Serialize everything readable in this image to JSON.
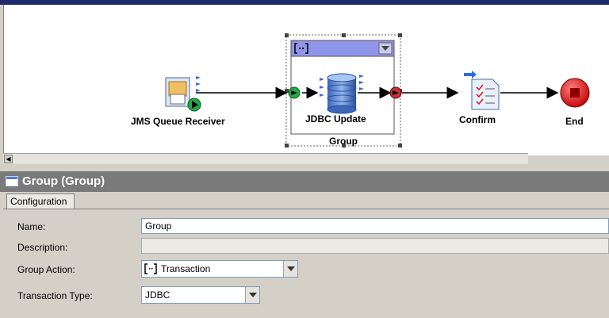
{
  "canvas": {
    "nodes": {
      "jms": "JMS Queue Receiver",
      "jdbc": "JDBC Update",
      "confirm": "Confirm",
      "end": "End"
    },
    "group_label": "Group"
  },
  "panel": {
    "title": "Group (Group)",
    "tab": "Configuration",
    "fields": {
      "name_label": "Name:",
      "name_value": "Group",
      "description_label": "Description:",
      "description_value": "",
      "group_action_label": "Group Action:",
      "group_action_value": "Transaction",
      "transaction_type_label": "Transaction Type:",
      "transaction_type_value": "JDBC"
    }
  },
  "icons": {
    "jms": "jms-queue-receiver-icon",
    "jdbc": "database-icon",
    "confirm": "confirm-checklist-icon",
    "end": "end-stop-icon",
    "group": "group-bracket-icon"
  },
  "colors": {
    "accent": "#1f2a6b",
    "group_header": "#8f95e8",
    "end_red": "#e02020",
    "start_green": "#22aa44"
  }
}
